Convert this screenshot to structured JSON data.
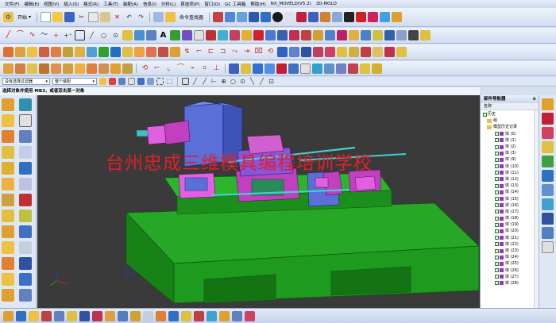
{
  "menu": {
    "file": "文件(F)",
    "edit": "编辑(E)",
    "view": "视图(V)",
    "insert": "插入(S)",
    "format": "格式(R)",
    "tools": "工具(T)",
    "assembly": "装配(A)",
    "info": "信息(I)",
    "analysis": "分析(L)",
    "preferences": "首选项(P)",
    "window": "窗口(O)",
    "gc_toolbox": "GC 工具箱",
    "help": "帮助(H)"
  },
  "window_title": "NX_MOVELD(V5.2)",
  "window_title2": "3D-MOLD",
  "toolbar": {
    "start_label": "开始",
    "command_finder_label": "命令查找器"
  },
  "selection_bar": {
    "filter_value": "没有选择过滤器",
    "scope_value": "整个装配"
  },
  "cue_line": "选择对象并使用 MB3，或者双击某一对象",
  "watermark": "台州忠成三维模具编程培训学校",
  "navigator": {
    "title": "部件导航器",
    "column_header": "名称",
    "items": [
      {
        "label": "历史",
        "type": "root"
      },
      {
        "label": "组",
        "type": "folder"
      },
      {
        "label": "模型历史记录",
        "type": "folder"
      },
      {
        "label": "体 (0)"
      },
      {
        "label": "体 (1)"
      },
      {
        "label": "体 (2)"
      },
      {
        "label": "体 (3)"
      },
      {
        "label": "体 (9)"
      },
      {
        "label": "体 (10)"
      },
      {
        "label": "体 (11)"
      },
      {
        "label": "体 (12)"
      },
      {
        "label": "体 (13)"
      },
      {
        "label": "体 (14)"
      },
      {
        "label": "体 (15)"
      },
      {
        "label": "体 (16)"
      },
      {
        "label": "体 (17)"
      },
      {
        "label": "体 (18)"
      },
      {
        "label": "体 (19)"
      },
      {
        "label": "体 (20)"
      },
      {
        "label": "体 (21)"
      },
      {
        "label": "体 (22)"
      },
      {
        "label": "体 (23)"
      },
      {
        "label": "体 (24)"
      },
      {
        "label": "体 (25)"
      },
      {
        "label": "体 (26)"
      },
      {
        "label": "体 (27)"
      },
      {
        "label": "体 (28)"
      }
    ]
  },
  "colors": {
    "viewport_bg": "#3a3a3a",
    "base_green": "#1fa81f",
    "housing_blue": "#5a6fd8",
    "part_magenta": "#c040c0",
    "watermark_red": "#e0202a"
  }
}
